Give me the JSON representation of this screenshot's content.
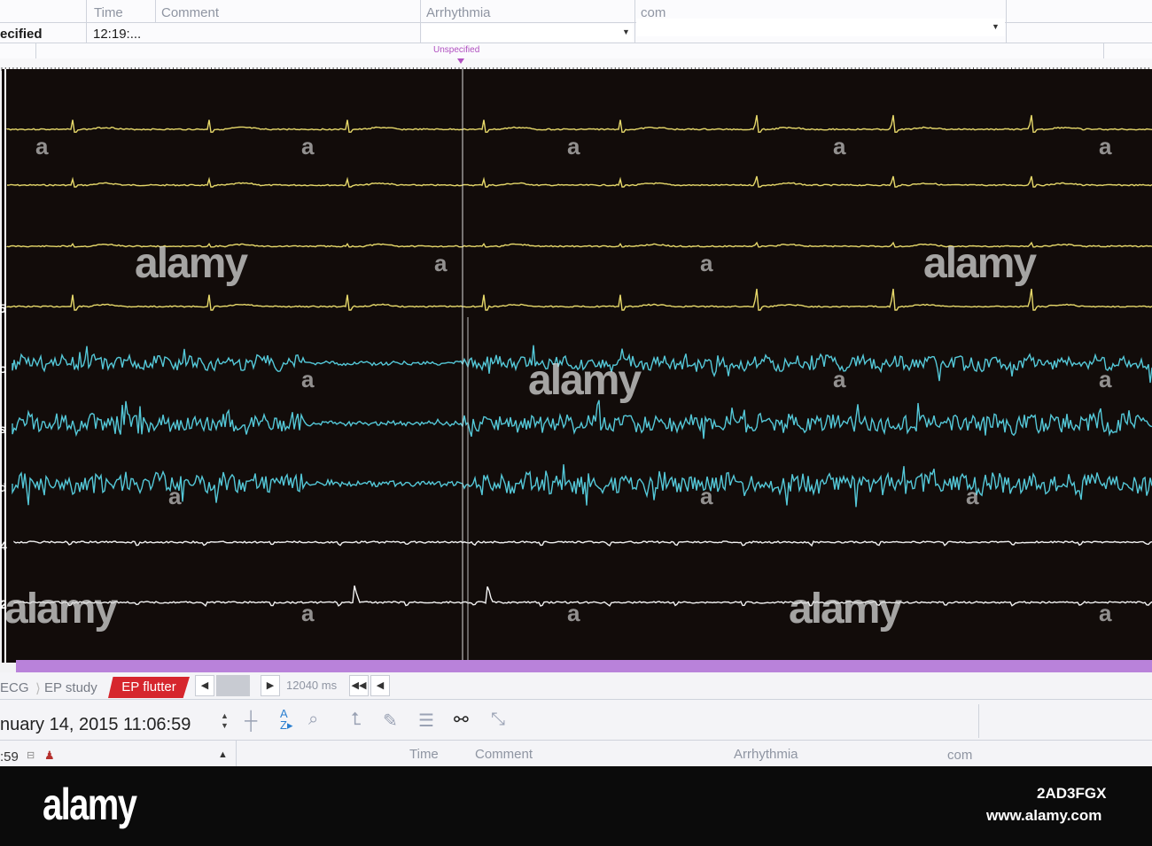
{
  "top_grid": {
    "headers": {
      "time": "Time",
      "comment": "Comment",
      "arrhythmia": "Arrhythmia",
      "com": "com"
    },
    "row": {
      "type_partial": "ecified",
      "time": "12:19:..."
    },
    "marker_label": "Unspecified"
  },
  "bottom_tabs": {
    "ecg": "ECG",
    "ep_study": "EP study",
    "ep_flutter": "EP flutter"
  },
  "scroll": {
    "duration": "12040 ms"
  },
  "bottom_panel": {
    "date": "nuary 14, 2015   11:06:59",
    "left_time": ":59",
    "headers": {
      "time": "Time",
      "comment": "Comment",
      "arrhythmia": "Arrhythmia",
      "com": "com"
    }
  },
  "channel_labels": [
    "5",
    "o",
    "s",
    "d",
    "4",
    "2"
  ],
  "watermark": {
    "logo": "alamy",
    "letter": "a"
  },
  "footer": {
    "logo": "alamy",
    "image_id": "2AD3FGX",
    "url": "www.alamy.com"
  },
  "colors": {
    "surface_ecg": "#e6d86a",
    "intracardiac": "#54c8d8",
    "mapping": "#f2f2f2",
    "background": "#120c0a",
    "active_tab": "#d6262d",
    "purple_bar": "#b982da"
  }
}
